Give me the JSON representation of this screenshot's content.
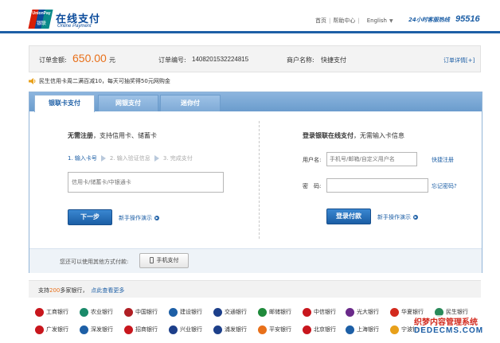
{
  "header": {
    "logo_en": "UnionPay",
    "logo_cn": "银联",
    "brand_cn": "在线支付",
    "brand_en": "Online Payment",
    "nav": [
      "首页",
      "帮助中心"
    ],
    "language": "English",
    "hotline_label": "24小时客服热线",
    "hotline_number": "95516",
    "accent_color": "#1d5fa6"
  },
  "order": {
    "amount_label": "订单金额:",
    "amount": "650.00",
    "amount_unit": "元",
    "order_no_label": "订单编号:",
    "order_no": "1408201532224815",
    "merchant_label": "商户名称:",
    "merchant": "快捷支付",
    "detail_link": "订单详情[+]"
  },
  "notice": {
    "icon": "speaker-icon",
    "text": "民生信用卡周二满百减10，每天可抽奖得50元网购金"
  },
  "tabs": [
    {
      "label": "银联卡支付",
      "active": true
    },
    {
      "label": "网银支付",
      "active": false
    },
    {
      "label": "迷你付",
      "active": false
    }
  ],
  "card_pay": {
    "title_bold": "无需注册",
    "title_rest": "，支持信用卡、储蓄卡",
    "steps": [
      "1. 输入卡号",
      "2. 输入验证信息",
      "3. 完成支付"
    ],
    "card_placeholder": "信用卡/储蓄卡/中银通卡",
    "next_button": "下一步",
    "help_link": "新手操作演示"
  },
  "login_pay": {
    "title_bold": "登录银联在线支付",
    "title_rest": "，无需输入卡信息",
    "username_label": "用户名:",
    "username_placeholder": "手机号/邮箱/自定义用户名",
    "register_link": "快捷注册",
    "password_label": "密　码:",
    "forgot_link": "忘记密码?",
    "login_button": "登录付款",
    "help_link": "新手操作演示"
  },
  "other_pay": {
    "text": "您还可以使用其他方式付款:",
    "mobile_button": "手机支付"
  },
  "banks_bar": {
    "prefix": "支持",
    "count": "200",
    "suffix": "多家银行，",
    "more_link": "点此查看更多"
  },
  "banks": [
    {
      "name": "工商银行",
      "color": "#c8161d"
    },
    {
      "name": "农业银行",
      "color": "#1a8a6a"
    },
    {
      "name": "中国银行",
      "color": "#b01f24"
    },
    {
      "name": "建设银行",
      "color": "#1d5fa6"
    },
    {
      "name": "交通银行",
      "color": "#1d3f8a"
    },
    {
      "name": "邮储银行",
      "color": "#1f8a3b"
    },
    {
      "name": "中信银行",
      "color": "#c8161d"
    },
    {
      "name": "光大银行",
      "color": "#6a2a8a"
    },
    {
      "name": "华夏银行",
      "color": "#d32a1e"
    },
    {
      "name": "民生银行",
      "color": "#2a8a5a"
    },
    {
      "name": "广发银行",
      "color": "#c8161d"
    },
    {
      "name": "深发银行",
      "color": "#1d5fa6"
    },
    {
      "name": "招商银行",
      "color": "#c8161d"
    },
    {
      "name": "兴业银行",
      "color": "#1d3f8a"
    },
    {
      "name": "浦发银行",
      "color": "#1d3f8a"
    },
    {
      "name": "平安银行",
      "color": "#e8701a"
    },
    {
      "name": "北京银行",
      "color": "#c8161d"
    },
    {
      "name": "上海银行",
      "color": "#1d5fa6"
    },
    {
      "name": "宁波银行",
      "color": "#e8a01a"
    }
  ],
  "watermark": {
    "line1": "织梦内容管理系统",
    "line2": "DEDECMS.COM"
  }
}
